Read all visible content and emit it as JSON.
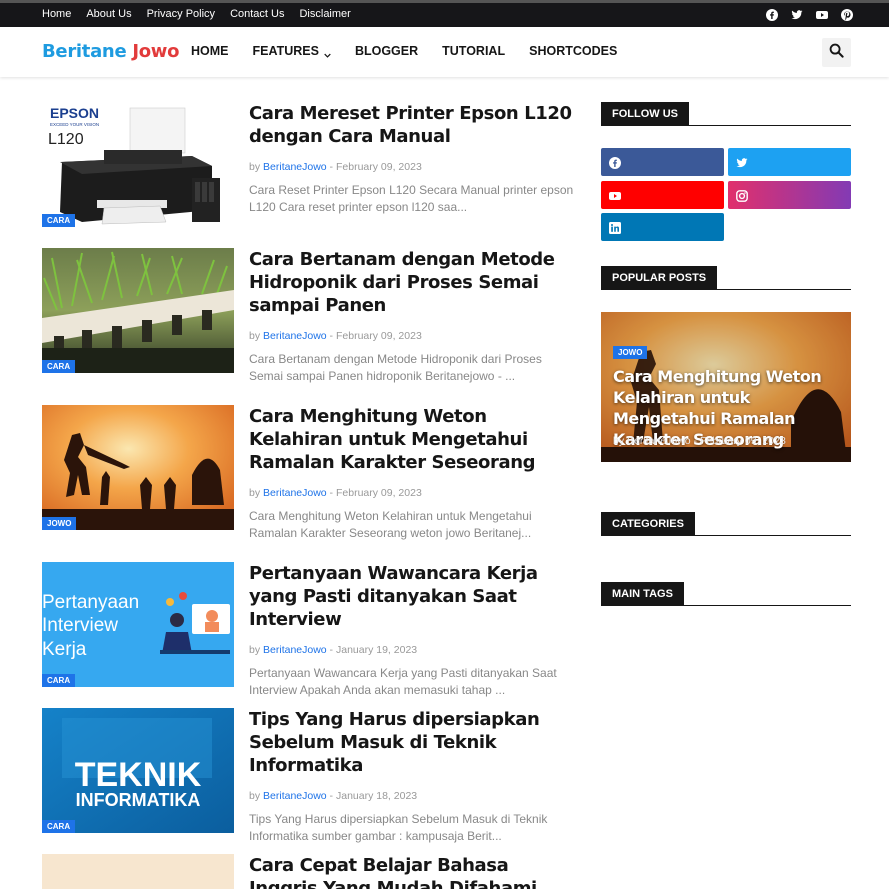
{
  "topbar": {
    "links": [
      "Home",
      "About Us",
      "Privacy Policy",
      "Contact Us",
      "Disclaimer"
    ],
    "social_icons": [
      "facebook-icon",
      "twitter-icon",
      "youtube-icon",
      "pinterest-icon"
    ]
  },
  "header": {
    "logo_part1": "Beritane",
    "logo_part2": "Jowo",
    "nav": [
      "HOME",
      "FEATURES",
      "BLOGGER",
      "TUTORIAL",
      "SHORTCODES"
    ]
  },
  "colors": {
    "accent": "#1e73e8",
    "logo_blue": "#1e9be0",
    "logo_red": "#e23b3b",
    "dark": "#161616"
  },
  "posts": [
    {
      "title": "Cara Mereset Printer Epson L120 dengan Cara Manual",
      "label": "CARA",
      "author": "BeritaneJowo",
      "date": "February 09, 2023",
      "snippet": "Cara Reset Printer Epson L120 Secara Manual printer epson L120 Cara reset printer epson l120 saa...",
      "thumb_text1": "EPSON",
      "thumb_text2": "EXCEED YOUR VISION",
      "thumb_text3": "L120"
    },
    {
      "title": "Cara Bertanam dengan Metode Hidroponik dari Proses Semai sampai Panen",
      "label": "CARA",
      "author": "BeritaneJowo",
      "date": "February 09, 2023",
      "snippet": "Cara Bertanam dengan Metode Hidroponik dari Proses Semai sampai Panen hidroponik Beritanejowo - ..."
    },
    {
      "title": "Cara Menghitung Weton Kelahiran untuk Mengetahui Ramalan Karakter Seseorang",
      "label": "JOWO",
      "author": "BeritaneJowo",
      "date": "February 09, 2023",
      "snippet": "Cara Menghitung Weton Kelahiran untuk Mengetahui Ramalan Karakter Seseorang weton jowo Beritanej..."
    },
    {
      "title": "Pertanyaan Wawancara Kerja yang Pasti ditanyakan Saat Interview",
      "label": "CARA",
      "author": "BeritaneJowo",
      "date": "January 19, 2023",
      "snippet": "Pertanyaan Wawancara Kerja yang Pasti ditanyakan Saat Interview Apakah Anda akan memasuki tahap ...",
      "thumb_text1": "Pertanyaan",
      "thumb_text2": "Interview",
      "thumb_text3": "Kerja"
    },
    {
      "title": "Tips Yang Harus dipersiapkan Sebelum Masuk di Teknik Informatika",
      "label": "CARA",
      "author": "BeritaneJowo",
      "date": "January 18, 2023",
      "snippet": "Tips Yang Harus dipersiapkan Sebelum Masuk di Teknik Informatika sumber gambar : kampusaja Berit...",
      "thumb_text1": "TEKNIK",
      "thumb_text2": "INFORMATIKA"
    },
    {
      "title": "Cara Cepat Belajar Bahasa Inggris Yang Mudah Difahami"
    }
  ],
  "sidebar": {
    "follow_us": "FOLLOW US",
    "popular_posts": "POPULAR POSTS",
    "categories": "CATEGORIES",
    "main_tags": "MAIN TAGS",
    "social_buttons": [
      {
        "icon": "facebook-icon",
        "color": "#3b5998"
      },
      {
        "icon": "twitter-icon",
        "color": "#1da1f2"
      },
      {
        "icon": "youtube-icon",
        "color": "#ff0000"
      },
      {
        "icon": "instagram-icon",
        "color": "#c13584"
      },
      {
        "icon": "linkedin-icon",
        "color": "#0077b5"
      }
    ],
    "popular": {
      "label": "JOWO",
      "title": "Cara Menghitung Weton Kelahiran untuk Mengetahui Ramalan Karakter Seseorang",
      "author": "BeritaneJowo",
      "date": "February 09, 2023"
    }
  }
}
